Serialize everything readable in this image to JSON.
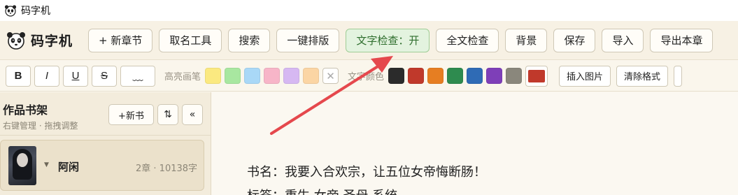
{
  "window": {
    "title": "码字机"
  },
  "brand": {
    "name": "码字机"
  },
  "toolbar": {
    "new_chapter": "+ 新章节",
    "naming_tool": "取名工具",
    "search": "搜索",
    "one_click_format": "一键排版",
    "text_check": "文字检查：开",
    "full_check": "全文检查",
    "background": "背景",
    "save": "保存",
    "import": "导入",
    "export_chapter": "导出本章"
  },
  "format_bar": {
    "bold": "B",
    "italic": "I",
    "underline": "U",
    "strike": "S",
    "wave": "﹏",
    "highlight_label": "高亮画笔",
    "highlight_colors": [
      "#fbe980",
      "#a8e7a0",
      "#a9d8f7",
      "#f7b5c8",
      "#d6b8f2",
      "#fbd5a4"
    ],
    "clear_highlight": "✕",
    "text_color_label": "文字颜色",
    "text_colors": [
      "#2b2b2b",
      "#c0392b",
      "#e67e22",
      "#2e8b4f",
      "#2f6bb5",
      "#7e3fb8",
      "#8a877c"
    ],
    "current_color": "#c0392b",
    "insert_image": "插入图片",
    "clear_format": "清除格式"
  },
  "sidebar": {
    "title": "作品书架",
    "subtitle": "右键管理 · 拖拽调整",
    "new_book": "+新书",
    "sort_icon": "⇅",
    "collapse_icon": "«",
    "books": [
      {
        "name": "阿闲",
        "stats": "2章 · 10138字"
      }
    ]
  },
  "editor": {
    "line1": "书名：我要入合欢宗，让五位女帝悔断肠！",
    "line2": "标签：重生 女帝 圣母 系统"
  },
  "colors": {
    "accent_green": "#2f6e2e",
    "arrow_red": "#e5484d"
  }
}
